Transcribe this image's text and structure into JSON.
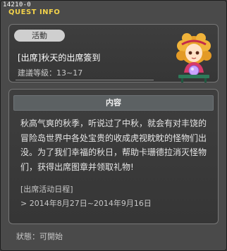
{
  "window": {
    "quest_id": "14210-0",
    "title": "QUEST INFO"
  },
  "event": {
    "tag": "活動",
    "name": "[出席]秋天的出席簽到",
    "level": "建議等級：13~17"
  },
  "content": {
    "header": "内容",
    "description_lines": [
      "秋高气爽的秋季，听说过了中秋，就会有对丰饶的",
      "冒险岛世界中各处宝贵的收成虎视眈眈的怪物们出",
      "没。为了我们幸福的秋日，帮助卡珊德拉消灭怪物",
      "们，获得出席图章并领取礼物!"
    ],
    "schedule_title": "[出席活动日程]",
    "schedule_item": "> 2014年8月27日~2014年9月16日"
  },
  "status": {
    "text": "狀態：可開始"
  },
  "colors": {
    "title_yellow": "#f2d24a",
    "panel_bg": "#3a3a3a",
    "window_bg": "#4a4a4a"
  },
  "icons": {
    "npc": "fortune-teller-npc-icon"
  }
}
